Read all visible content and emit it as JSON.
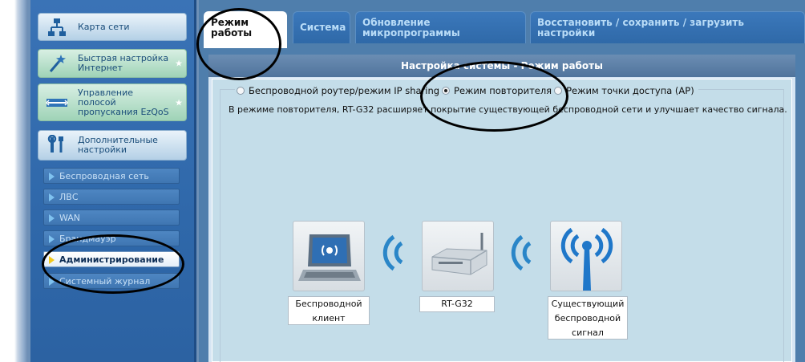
{
  "sidebar": {
    "menu": [
      {
        "label": "Карта сети",
        "icon": "network-map-icon"
      },
      {
        "label": "Быстрая настройка Интернет",
        "icon": "magic-wand-icon"
      },
      {
        "label": "Управление полосой пропускания EzQoS",
        "icon": "bandwidth-icon"
      },
      {
        "label": "Дополнительные настройки",
        "icon": "tools-icon"
      }
    ],
    "submenu": [
      {
        "label": "Беспроводная сеть"
      },
      {
        "label": "ЛВС"
      },
      {
        "label": "WAN"
      },
      {
        "label": "Брандмауэр"
      },
      {
        "label": "Администрирование",
        "active": true
      },
      {
        "label": "Системный журнал"
      }
    ]
  },
  "tabs": [
    {
      "label": "Режим работы",
      "active": true
    },
    {
      "label": "Система"
    },
    {
      "label": "Обновление микропрограммы"
    },
    {
      "label": "Восстановить / сохранить / загрузить настройки"
    }
  ],
  "panel": {
    "title": "Настройка системы - Режим работы",
    "modes": [
      {
        "label": "Беспроводной роутер/режим IP sharing",
        "selected": false
      },
      {
        "label": "Режим повторителя",
        "selected": true
      },
      {
        "label": "Режим точки доступа (AP)",
        "selected": false
      }
    ],
    "description": "В режиме повторителя, RT-G32 расширяет покрытие существующей беспроводной сети и улучшает качество сигнала.",
    "diagram": {
      "client_caption": "Беспроводной клиент",
      "router_caption": "RT-G32",
      "signal_caption": "Существующий беспроводной сигнал"
    }
  },
  "colors": {
    "sidebar_blue": "#2f68aa",
    "tab_text": "#b9dcf7",
    "panel_bg": "#c4dde9",
    "wave_blue": "#2a86c8"
  }
}
